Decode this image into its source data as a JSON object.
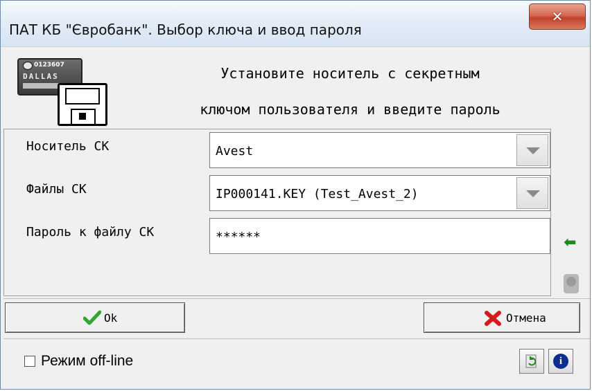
{
  "window": {
    "title": "ПАТ КБ \"Євробанк\". Выбор ключа и ввод пароля"
  },
  "header": {
    "instruction_line1": "Установите носитель с секретным",
    "instruction_line2": "ключом пользователя и введите пароль",
    "dallas_number": "0123607",
    "dallas_brand": "DALLAS"
  },
  "form": {
    "media_label": "Носитель СК",
    "media_value": "Avest",
    "files_label": "Файлы СК",
    "files_value": "IP000141.KEY (Test_Avest_2)",
    "password_label": "Пароль к файлу СК",
    "password_value": "******"
  },
  "buttons": {
    "ok_label": "Ok",
    "cancel_label": "Отмена"
  },
  "footer": {
    "offline_label": "Режим off-line",
    "offline_checked": false
  },
  "colors": {
    "ok_check": "#2fa82f",
    "cancel_cross": "#d61b1b",
    "arrow": "#1e8a1e",
    "info": "#0b2f8f"
  },
  "icons": {
    "close": "close-icon",
    "dallas": "dallas-key-icon",
    "floppy": "floppy-disk-icon",
    "arrow": "green-arrow-left-icon",
    "keys": "key-icon",
    "check": "checkmark-icon",
    "cross": "cross-icon",
    "refresh": "refresh-icon",
    "info": "info-icon"
  }
}
